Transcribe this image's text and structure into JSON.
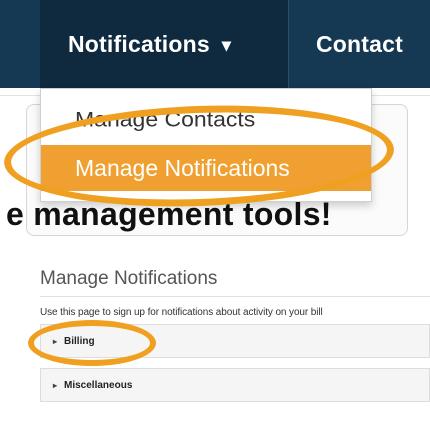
{
  "nav": {
    "notifications_label": "Notifications",
    "caret": "▾",
    "contact_label": "Contact"
  },
  "dropdown": {
    "items": [
      {
        "label": "Manage Contacts"
      },
      {
        "label": "Manage Notifications",
        "active": true
      }
    ]
  },
  "hero": {
    "heading_fragment": "e management tools!"
  },
  "manage_page": {
    "title": "Manage Notifications",
    "intro": "Use this page to sign up for notifications about activity on your bill",
    "sections": [
      {
        "label": "Billing",
        "caret": "▸"
      },
      {
        "label": "Miscellaneous",
        "caret": "▸"
      }
    ]
  },
  "colors": {
    "navbar": "#163953",
    "nav_active": "#0f2a3e",
    "highlight": "#f0a030",
    "annotation_ring": "#f0a020"
  }
}
